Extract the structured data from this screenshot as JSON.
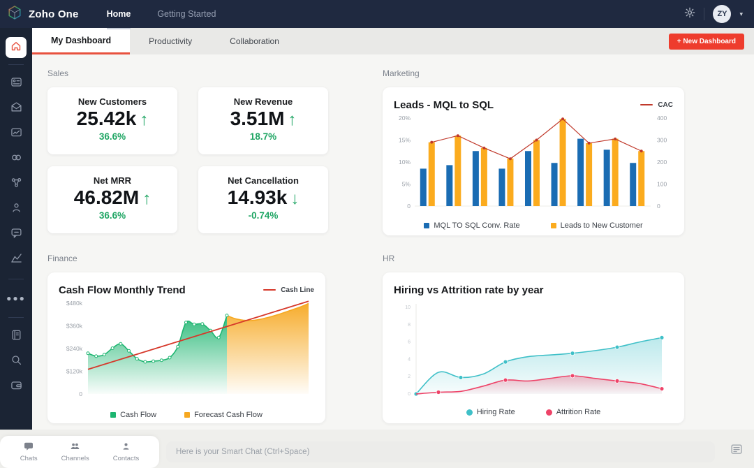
{
  "topbar": {
    "brand": "Zoho One",
    "nav": [
      {
        "label": "Home",
        "active": true
      },
      {
        "label": "Getting Started",
        "active": false
      }
    ],
    "avatar_initials": "ZY"
  },
  "sidebar": {
    "icons": [
      "apps",
      "mail",
      "projects",
      "social",
      "connect",
      "people",
      "chat",
      "analytics"
    ],
    "more_icons": [
      "notebook",
      "search",
      "wallet"
    ]
  },
  "tabs": {
    "items": [
      {
        "label": "My Dashboard",
        "active": true
      },
      {
        "label": "Productivity",
        "active": false
      },
      {
        "label": "Collaboration",
        "active": false
      }
    ],
    "new_dashboard_label": "+ New Dashboard"
  },
  "sections": {
    "sales": {
      "label": "Sales",
      "cards": [
        {
          "title": "New Customers",
          "value": "25.42k",
          "arrow": "↑",
          "change": "36.6%"
        },
        {
          "title": "New Revenue",
          "value": "3.51M",
          "arrow": "↑",
          "change": "18.7%"
        },
        {
          "title": "Net MRR",
          "value": "46.82M",
          "arrow": "↑",
          "change": "36.6%"
        },
        {
          "title": "Net Cancellation",
          "value": "14.93k",
          "arrow": "↓",
          "change": "-0.74%"
        }
      ],
      "positive_color": "#1ea563"
    },
    "marketing": {
      "label": "Marketing"
    },
    "finance": {
      "label": "Finance"
    },
    "hr": {
      "label": "HR"
    }
  },
  "chart_data": [
    {
      "id": "marketing",
      "type": "bar",
      "title": "Leads - MQL to SQL",
      "top_legend": {
        "label": "CAC",
        "color": "#c0392b"
      },
      "left_axis": {
        "ticks": [
          "20%",
          "15%",
          "10%",
          "5%",
          "0"
        ],
        "max": 20
      },
      "right_axis": {
        "ticks": [
          "400",
          "300",
          "200",
          "100",
          "0"
        ],
        "max": 400
      },
      "series": [
        {
          "name": "MQL TO SQL Conv. Rate",
          "type": "bar",
          "color": "#1a6cb3",
          "values": [
            8.5,
            9.3,
            12.5,
            8.5,
            12.5,
            9.8,
            15.3,
            12.8,
            9.8
          ]
        },
        {
          "name": "Leads to New Customer",
          "type": "bar",
          "color": "#fbab1e",
          "values": [
            14.5,
            16,
            13.2,
            10.8,
            15,
            19.8,
            14.3,
            15.3,
            12.5
          ]
        },
        {
          "name": "CAC",
          "type": "line",
          "axis": "right",
          "color": "#c0392b",
          "values": [
            290,
            320,
            264,
            215,
            300,
            396,
            286,
            305,
            250
          ]
        }
      ],
      "legend_position": "bottom"
    },
    {
      "id": "finance",
      "type": "area",
      "title": "Cash Flow Monthly Trend",
      "top_legend": {
        "label": "Cash Line",
        "color": "#d6382a"
      },
      "left_axis": {
        "ticks": [
          "$480k",
          "$360k",
          "$240k",
          "$120k",
          "0"
        ],
        "max": 480
      },
      "series": [
        {
          "name": "Cash Flow",
          "type": "area",
          "color": "#1db570",
          "values": [
            215,
            200,
            208,
            242,
            265,
            228,
            186,
            170,
            173,
            178,
            192,
            250,
            378,
            368,
            370,
            335,
            298,
            415
          ]
        },
        {
          "name": "Forecast Cash Flow",
          "type": "area",
          "color": "#f6a821",
          "values": [
            415,
            398,
            390,
            388,
            394,
            404,
            416,
            430,
            445,
            460,
            478
          ]
        },
        {
          "name": "Cash Line",
          "type": "line",
          "color": "#d6382a",
          "values": [
            130,
            490
          ]
        }
      ],
      "legend_position": "bottom"
    },
    {
      "id": "hr",
      "type": "line",
      "title": "Hiring vs Attrition rate by year",
      "left_axis": {
        "ticks": [
          "10",
          "8",
          "6",
          "4",
          "2",
          "0"
        ],
        "max": 10
      },
      "series": [
        {
          "name": "Hiring Rate",
          "type": "line",
          "color": "#3fc0c8",
          "values": [
            0,
            2.5,
            1.9,
            2.3,
            3.7,
            4.3,
            4.5,
            4.7,
            5.0,
            5.4,
            6.0,
            6.5
          ],
          "marker_indices": [
            0,
            2,
            4,
            7,
            9,
            11
          ]
        },
        {
          "name": "Attrition Rate",
          "type": "line",
          "color": "#ee4368",
          "values": [
            0,
            0.2,
            0.3,
            0.9,
            1.6,
            1.5,
            1.8,
            2.1,
            1.8,
            1.5,
            1.2,
            0.6
          ],
          "marker_indices": [
            1,
            4,
            7,
            9,
            11
          ]
        }
      ],
      "legend_position": "bottom"
    }
  ],
  "footer": {
    "items": [
      {
        "label": "Chats",
        "icon": "chats"
      },
      {
        "label": "Channels",
        "icon": "channels"
      },
      {
        "label": "Contacts",
        "icon": "contacts"
      }
    ],
    "chat_placeholder": "Here is your Smart Chat (Ctrl+Space)"
  }
}
